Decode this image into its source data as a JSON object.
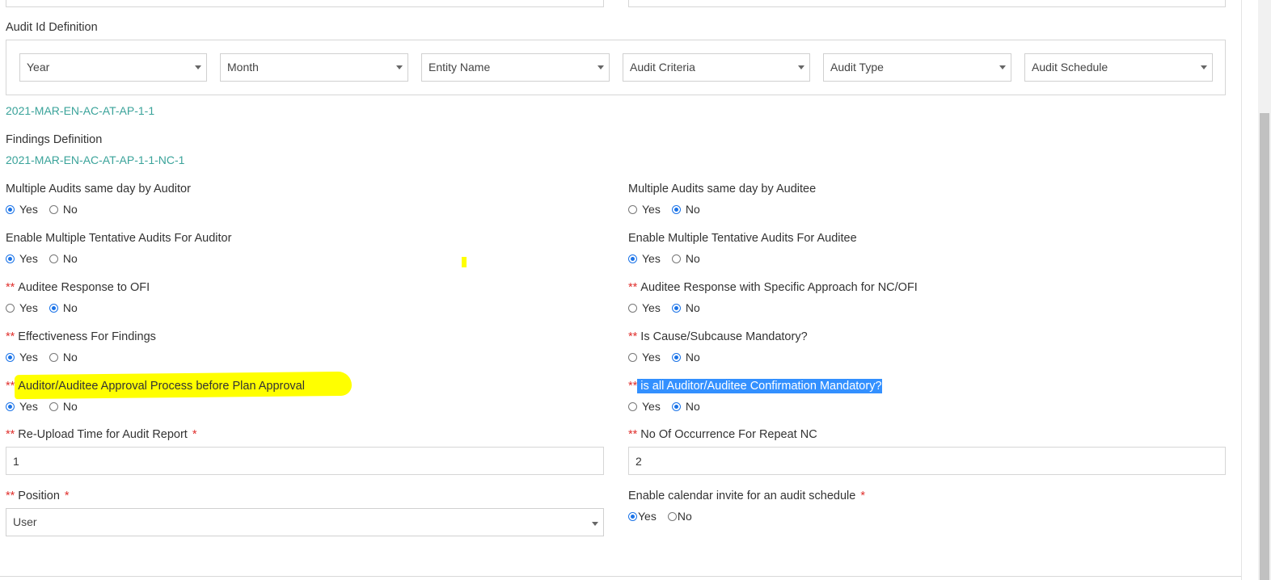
{
  "audit_id": {
    "title": "Audit Id Definition",
    "selects": [
      {
        "label": "Year"
      },
      {
        "label": "Month"
      },
      {
        "label": "Entity Name"
      },
      {
        "label": "Audit Criteria"
      },
      {
        "label": "Audit Type"
      },
      {
        "label": "Audit Schedule"
      }
    ],
    "preview": "2021-MAR-EN-AC-AT-AP-1-1"
  },
  "findings": {
    "title": "Findings Definition",
    "preview": "2021-MAR-EN-AC-AT-AP-1-1-NC-1"
  },
  "options": {
    "yes": "Yes",
    "no": "No",
    "double_star": "**",
    "required_star": "*"
  },
  "settings": {
    "multi_audits_auditor": {
      "label": "Multiple Audits same day by Auditor",
      "value": "Yes"
    },
    "multi_audits_auditee": {
      "label": "Multiple Audits same day by Auditee",
      "value": "No"
    },
    "tentative_auditor": {
      "label": "Enable Multiple Tentative Audits For Auditor",
      "value": "Yes"
    },
    "tentative_auditee": {
      "label": "Enable Multiple Tentative Audits For Auditee",
      "value": "Yes"
    },
    "response_ofi": {
      "label": "Auditee Response to OFI",
      "value": "No"
    },
    "response_specific": {
      "label": "Auditee Response with Specific Approach for NC/OFI",
      "value": "No"
    },
    "effectiveness": {
      "label": "Effectiveness For Findings",
      "value": "Yes"
    },
    "cause_mandatory": {
      "label": "Is Cause/Subcause Mandatory?",
      "value": "No"
    },
    "approval_process": {
      "label": "Auditor/Auditee Approval Process before Plan Approval",
      "value": "Yes"
    },
    "confirmation_mandatory": {
      "label": "is all Auditor/Auditee Confirmation Mandatory?",
      "value": "No"
    },
    "reupload_time": {
      "label": "Re-Upload Time for Audit Report",
      "value": "1"
    },
    "repeat_nc": {
      "label": "No Of Occurrence For Repeat NC",
      "value": "2"
    },
    "position": {
      "label": "Position",
      "value": "User"
    },
    "calendar_invite": {
      "label": "Enable calendar invite for an audit schedule",
      "value": "Yes"
    }
  },
  "colors": {
    "accent_teal": "#3aa39a",
    "required_red": "#e0302d",
    "radio_blue": "#1a73e8",
    "highlight_yellow": "#ffff00",
    "selection_blue": "#3390ff"
  }
}
